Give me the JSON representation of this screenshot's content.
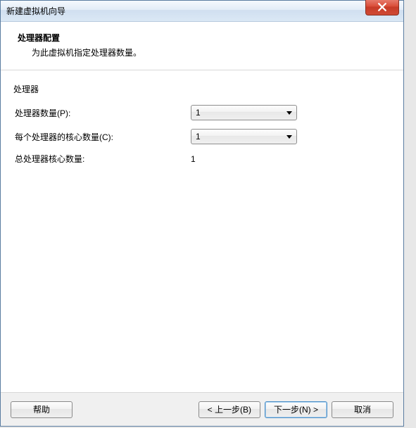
{
  "window": {
    "title": "新建虚拟机向导"
  },
  "header": {
    "title": "处理器配置",
    "subtitle": "为此虚拟机指定处理器数量。"
  },
  "form": {
    "group_label": "处理器",
    "proc_count_label": "处理器数量(P):",
    "proc_count_value": "1",
    "cores_per_proc_label": "每个处理器的核心数量(C):",
    "cores_per_proc_value": "1",
    "total_cores_label": "总处理器核心数量:",
    "total_cores_value": "1"
  },
  "buttons": {
    "help": "帮助",
    "back": "< 上一步(B)",
    "next": "下一步(N) >",
    "cancel": "取消"
  }
}
